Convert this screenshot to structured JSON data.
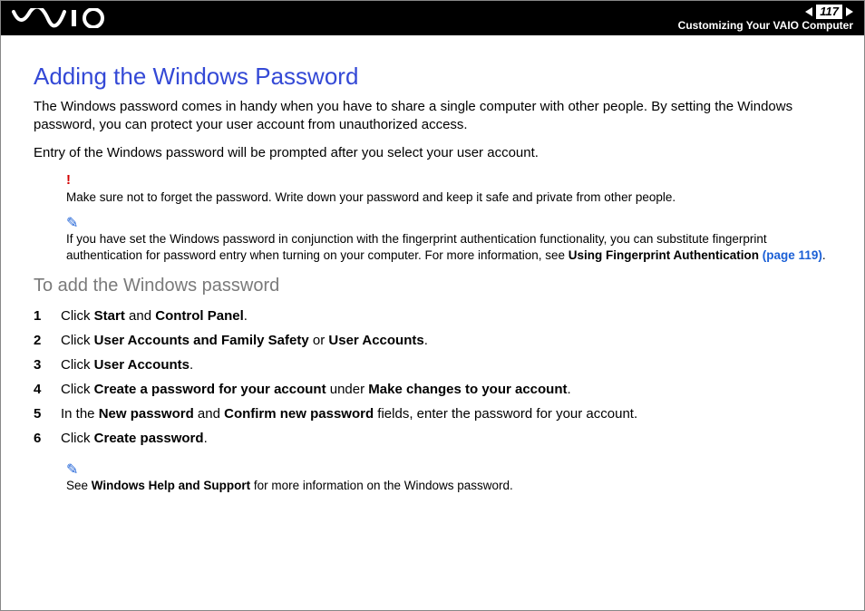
{
  "header": {
    "page_number": "117",
    "section": "Customizing Your VAIO Computer"
  },
  "title": "Adding the Windows Password",
  "para1": "The Windows password comes in handy when you have to share a single computer with other people. By setting the Windows password, you can protect your user account from unauthorized access.",
  "para2": "Entry of the Windows password will be prompted after you select your user account.",
  "warning": "Make sure not to forget the password. Write down your password and keep it safe and private from other people.",
  "note1_prefix": "If you have set the Windows password in conjunction with the fingerprint authentication functionality, you can substitute fingerprint authentication for password entry when turning on your computer. For more information, see ",
  "note1_bold": "Using Fingerprint Authentication ",
  "note1_link": "(page 119)",
  "note1_suffix": ".",
  "subtitle": "To add the Windows password",
  "steps": [
    {
      "n": "1",
      "a": "Click ",
      "b": "Start",
      "c": " and ",
      "d": "Control Panel",
      "e": "."
    },
    {
      "n": "2",
      "a": "Click ",
      "b": "User Accounts and Family Safety",
      "c": " or ",
      "d": "User Accounts",
      "e": "."
    },
    {
      "n": "3",
      "a": "Click ",
      "b": "User Accounts",
      "c": "."
    },
    {
      "n": "4",
      "a": "Click ",
      "b": "Create a password for your account",
      "c": " under ",
      "d": "Make changes to your account",
      "e": "."
    },
    {
      "n": "5",
      "a": "In the ",
      "b": "New password",
      "c": " and ",
      "d": "Confirm new password",
      "e": " fields, enter the password for your account."
    },
    {
      "n": "6",
      "a": "Click ",
      "b": "Create password",
      "c": "."
    }
  ],
  "note2_a": "See ",
  "note2_b": "Windows Help and Support",
  "note2_c": " for more information on the Windows password."
}
